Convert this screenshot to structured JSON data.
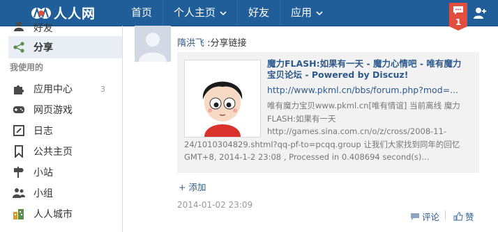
{
  "brand": {
    "name": "人人网"
  },
  "nav": {
    "items": [
      {
        "label": "首页"
      },
      {
        "label": "个人主页"
      },
      {
        "label": "好友"
      },
      {
        "label": "应用"
      }
    ]
  },
  "notifications": {
    "count": "1"
  },
  "sidebar": {
    "top_partial": "好友",
    "share": "分享",
    "heading": "我使用的",
    "items": [
      {
        "label": "应用中心",
        "count": "3"
      },
      {
        "label": "网页游戏"
      },
      {
        "label": "日志"
      },
      {
        "label": "公共主页"
      },
      {
        "label": "小站"
      },
      {
        "label": "小组"
      },
      {
        "label": "人人城市"
      }
    ]
  },
  "post": {
    "author": "隋洪飞",
    "action": ":分享链接",
    "card": {
      "title": "魔力FLASH:如果有一天 - 魔力心情吧 - 唯有魔力宝贝论坛 - Powered by Discuz!",
      "link": "http://www.pkml.cn/bbs/forum.php?mod=...",
      "desc_line1": "唯有魔力宝贝www.pkml.cn[唯有情谊] 当前离线 魔力",
      "desc_line2": "FLASH:如果有一天",
      "desc_line3": "http://games.sina.com.cn/o/z/cross/2008-11-",
      "desc_line4": "24/1010304829.shtml?qq-pf-to=pcqq.group 让我们大家找到同年的回忆",
      "desc_line5": "GMT+8, 2014-1-2 23:08 , Processed in 0.408694 second(s)..."
    },
    "add_label": "+ 添加",
    "time": "2014-01-02 23:09",
    "comment_label": "评论",
    "like_label": "赞"
  }
}
